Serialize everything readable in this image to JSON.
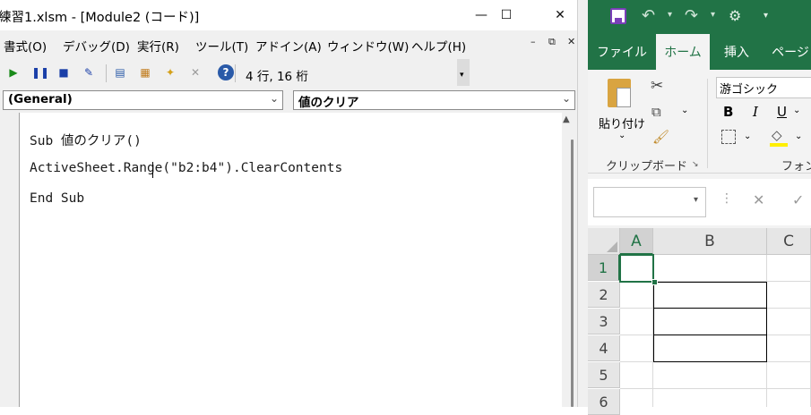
{
  "vba": {
    "title": "練習1.xlsm - [Module2 (コード)]",
    "window_controls": {
      "minimize": "—",
      "maximize": "☐",
      "close": "✕"
    },
    "menu": [
      "書式(O)",
      "デバッグ(D)",
      "実行(R)",
      "ツール(T)",
      "アドイン(A)",
      "ウィンドウ(W)",
      "ヘルプ(H)"
    ],
    "mdi_controls": {
      "minimize": "–",
      "restore": "⧉",
      "close": "✕"
    },
    "toolbar": {
      "cursor_position": "4 行, 16 桁"
    },
    "object_combo": "(General)",
    "procedure_combo": "値のクリア",
    "code_lines": [
      "Sub 値のクリア()",
      "ActiveSheet.Range(\"b2:b4\").ClearContents",
      "End Sub"
    ]
  },
  "excel": {
    "accent": "#217346",
    "tabs": {
      "file": "ファイル",
      "home": "ホーム",
      "insert": "挿入",
      "page": "ページ"
    },
    "ribbon": {
      "paste_label": "貼り付け",
      "clipboard_group": "クリップボード",
      "font_name": "游ゴシック",
      "font_group": "フォン",
      "bold": "B",
      "italic": "I",
      "underline": "U"
    },
    "columns": [
      "A",
      "B",
      "C"
    ],
    "rows": [
      "1",
      "2",
      "3",
      "4",
      "5",
      "6"
    ],
    "selected_cell": "A1"
  }
}
